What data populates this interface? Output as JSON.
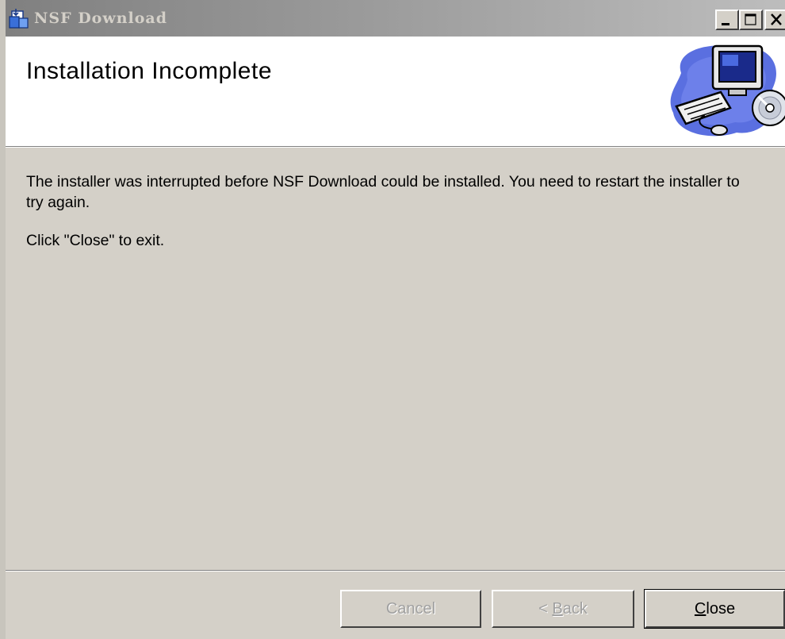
{
  "window": {
    "title": "NSF Download",
    "caption_buttons": {
      "minimize_icon": "minimize-icon",
      "maximize_icon": "maximize-icon",
      "close_icon": "close-icon"
    }
  },
  "banner": {
    "heading": "Installation Incomplete",
    "art_icon": "computer-with-cd-icon"
  },
  "body": {
    "message": "The installer was interrupted before NSF Download could be installed. You need to restart the installer to try again.",
    "instruction": "Click \"Close\" to exit."
  },
  "buttons": {
    "cancel_label": "Cancel",
    "back_prefix": "< ",
    "back_accel": "B",
    "back_rest": "ack",
    "close_accel": "C",
    "close_rest": "lose"
  },
  "colors": {
    "dialog_bg": "#d4d0c8",
    "banner_bg": "#ffffff",
    "titlebar_inactive_start": "#808080",
    "titlebar_inactive_end": "#bdbdbd",
    "disabled_text": "#a0a0a0"
  }
}
